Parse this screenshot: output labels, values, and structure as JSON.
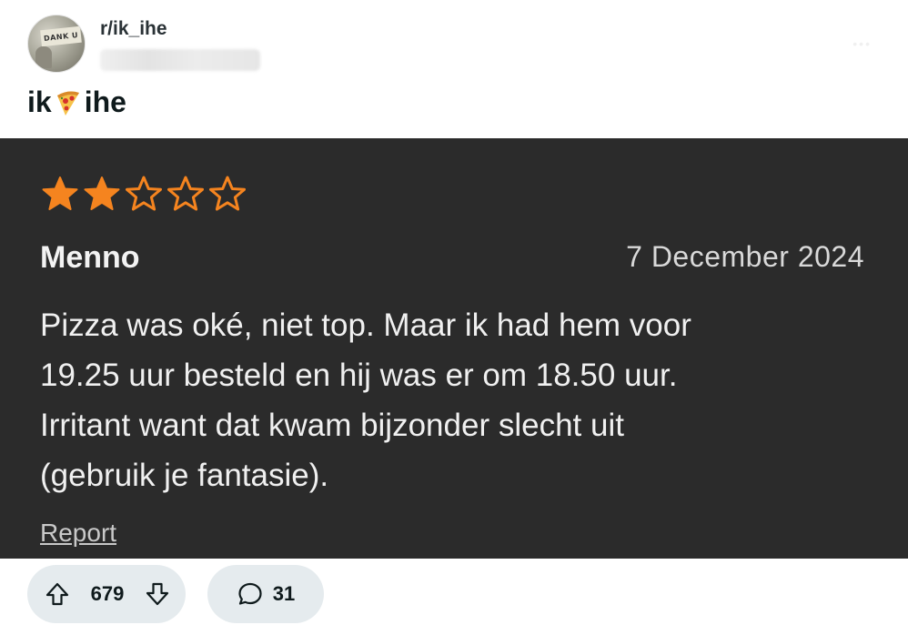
{
  "header": {
    "subreddit": "r/ik_ihe",
    "avatar_sign_text": "DANK U"
  },
  "post": {
    "title_prefix": "ik",
    "title_icon": "pizza-icon",
    "title_suffix": "ihe"
  },
  "review": {
    "rating": 2,
    "max_rating": 5,
    "star_color": "#f5841f",
    "reviewer": "Menno",
    "date": "7 December 2024",
    "text": "Pizza was oké, niet top. Maar ik had hem voor\n19.25 uur besteld en hij was er om 18.50 uur.\nIrritant want dat kwam bijzonder slecht uit\n(gebruik je fantasie).",
    "report_label": "Report"
  },
  "actions": {
    "vote_count": "679",
    "comment_count": "31"
  }
}
